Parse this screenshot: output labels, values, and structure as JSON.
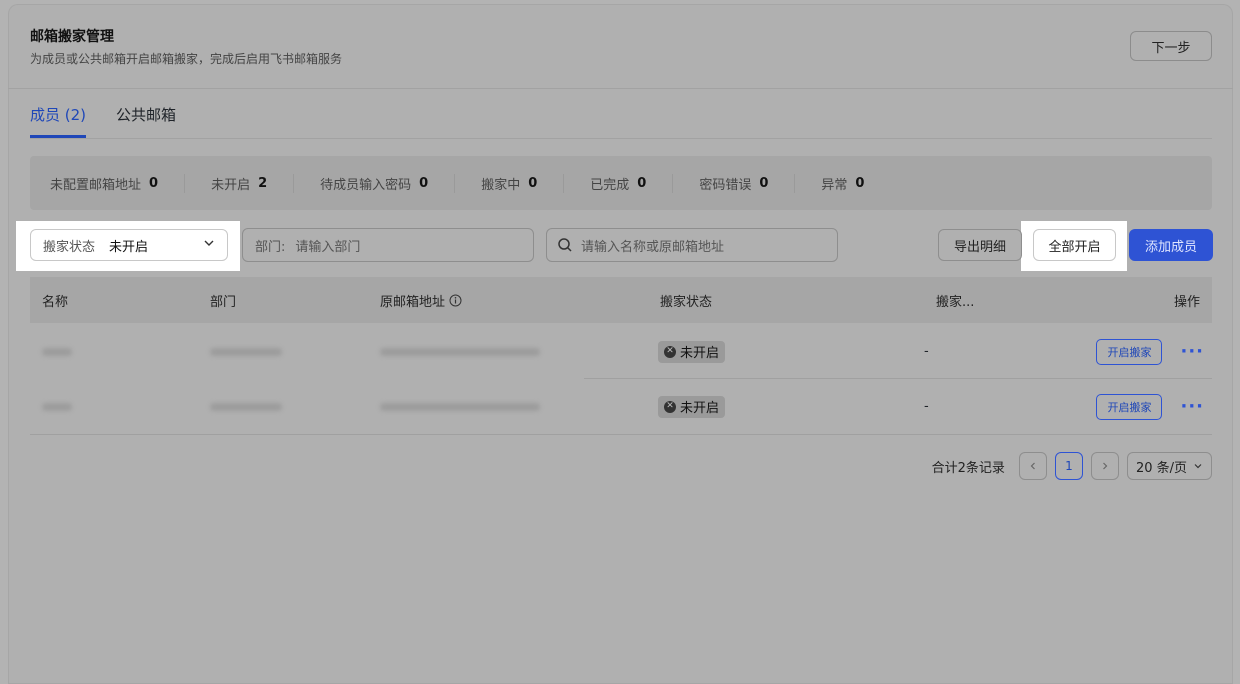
{
  "header": {
    "title": "邮箱搬家管理",
    "subtitle": "为成员或公共邮箱开启邮箱搬家，完成后启用飞书邮箱服务",
    "next_label": "下一步"
  },
  "tabs": [
    {
      "label": "成员 (2)",
      "active": true
    },
    {
      "label": "公共邮箱",
      "active": false
    }
  ],
  "stats": [
    {
      "label": "未配置邮箱地址",
      "value": "0"
    },
    {
      "label": "未开启",
      "value": "2"
    },
    {
      "label": "待成员输入密码",
      "value": "0"
    },
    {
      "label": "搬家中",
      "value": "0"
    },
    {
      "label": "已完成",
      "value": "0"
    },
    {
      "label": "密码错误",
      "value": "0"
    },
    {
      "label": "异常",
      "value": "0"
    }
  ],
  "filters": {
    "status_label": "搬家状态",
    "status_value": "未开启",
    "dept_label": "部门:",
    "dept_placeholder": "请输入部门",
    "search_placeholder": "请输入名称或原邮箱地址"
  },
  "actions": {
    "export": "导出明细",
    "enable_all": "全部开启",
    "add_member": "添加成员"
  },
  "table": {
    "columns": [
      "名称",
      "部门",
      "原邮箱地址",
      "搬家状态",
      "搬家...",
      "操作"
    ],
    "rows": [
      {
        "status": "未开启",
        "progress": "-",
        "action": "开启搬家"
      },
      {
        "status": "未开启",
        "progress": "-",
        "action": "开启搬家"
      }
    ]
  },
  "pagination": {
    "total": "合计2条记录",
    "page": "1",
    "page_size": "20 条/页"
  },
  "colors": {
    "primary": "#2e53d4",
    "highlight": "#ffffff"
  }
}
